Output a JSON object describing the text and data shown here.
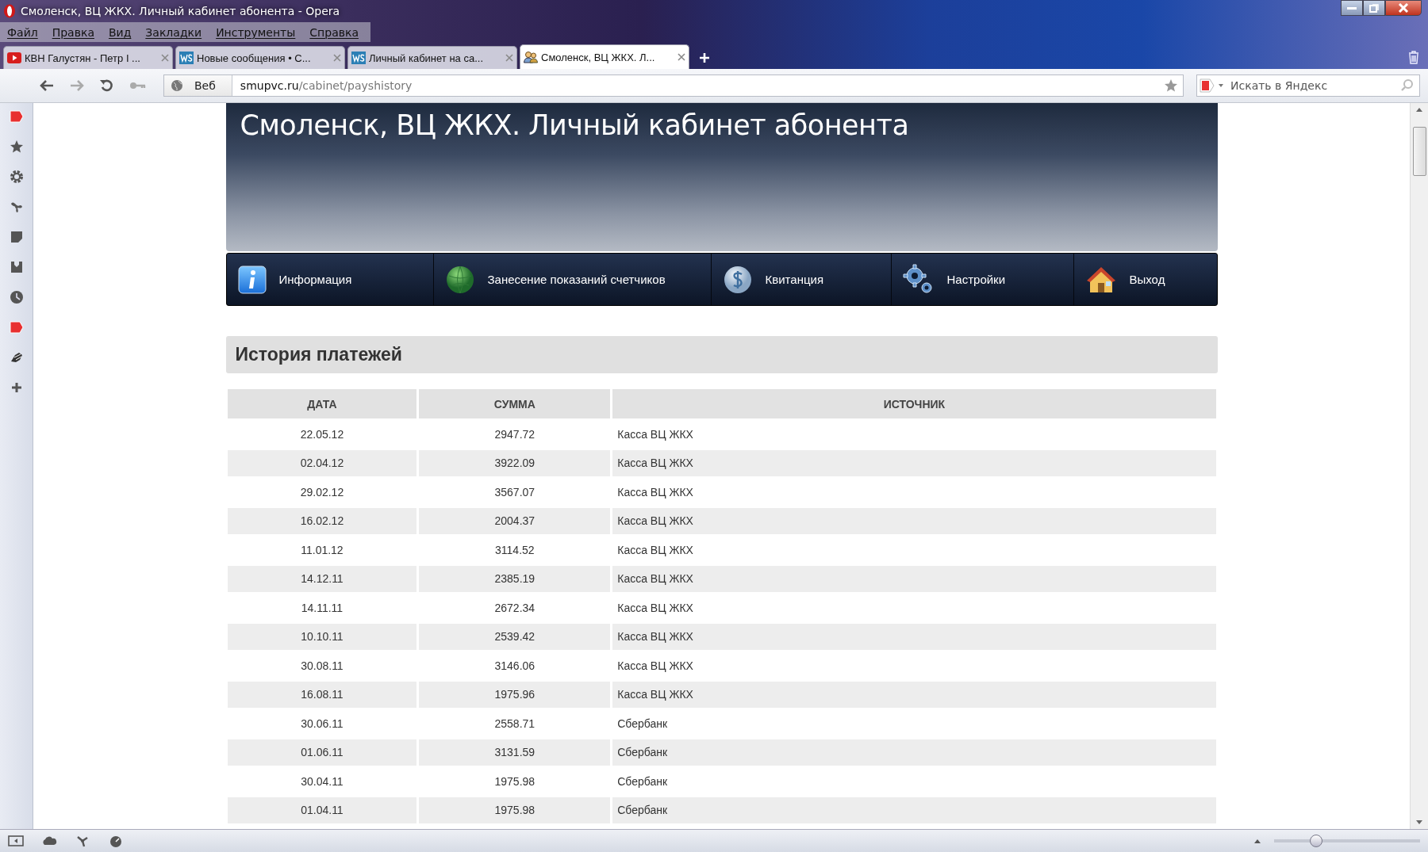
{
  "window": {
    "title": "Смоленск, ВЦ ЖКХ. Личный кабинет абонента - Opera"
  },
  "menu": [
    "Файл",
    "Правка",
    "Вид",
    "Закладки",
    "Инструменты",
    "Справка"
  ],
  "tabs": [
    {
      "label": "КВН Галустян - Петр I ...",
      "kind": "video",
      "selected": false
    },
    {
      "label": "Новые сообщения • С...",
      "kind": "ws",
      "selected": false
    },
    {
      "label": "Личный кабинет на са...",
      "kind": "ws",
      "selected": false
    },
    {
      "label": "Смоленск, ВЦ ЖКХ. Л...",
      "kind": "people",
      "selected": true
    }
  ],
  "address_bar": {
    "mode": "Веб",
    "host": "smupvc.ru",
    "path": "/cabinet/payshistory"
  },
  "search": {
    "placeholder": "Искать в Яндекс"
  },
  "zoom": {
    "level": 0.28
  },
  "page": {
    "title": "Смоленск, ВЦ ЖКХ. Личный кабинет абонента",
    "nav": [
      {
        "label": "Информация",
        "kind": "info"
      },
      {
        "label": "Занесение показаний счетчиков",
        "kind": "globe"
      },
      {
        "label": "Квитанция",
        "kind": "coin"
      },
      {
        "label": "Настройки",
        "kind": "gears"
      },
      {
        "label": "Выход",
        "kind": "house"
      }
    ],
    "section_title": "История платежей",
    "table": {
      "columns": [
        "ДАТА",
        "СУММА",
        "ИСТОЧНИК"
      ],
      "rows": [
        [
          "22.05.12",
          "2947.72",
          "Касса ВЦ ЖКХ"
        ],
        [
          "02.04.12",
          "3922.09",
          "Касса ВЦ ЖКХ"
        ],
        [
          "29.02.12",
          "3567.07",
          "Касса ВЦ ЖКХ"
        ],
        [
          "16.02.12",
          "2004.37",
          "Касса ВЦ ЖКХ"
        ],
        [
          "11.01.12",
          "3114.52",
          "Касса ВЦ ЖКХ"
        ],
        [
          "14.12.11",
          "2385.19",
          "Касса ВЦ ЖКХ"
        ],
        [
          "14.11.11",
          "2672.34",
          "Касса ВЦ ЖКХ"
        ],
        [
          "10.10.11",
          "2539.42",
          "Касса ВЦ ЖКХ"
        ],
        [
          "30.08.11",
          "3146.06",
          "Касса ВЦ ЖКХ"
        ],
        [
          "16.08.11",
          "1975.96",
          "Касса ВЦ ЖКХ"
        ],
        [
          "30.06.11",
          "2558.71",
          "Сбербанк"
        ],
        [
          "01.06.11",
          "3131.59",
          "Сбербанк"
        ],
        [
          "30.04.11",
          "1975.98",
          "Сбербанк"
        ],
        [
          "01.04.11",
          "1975.98",
          "Сбербанк"
        ]
      ]
    }
  }
}
